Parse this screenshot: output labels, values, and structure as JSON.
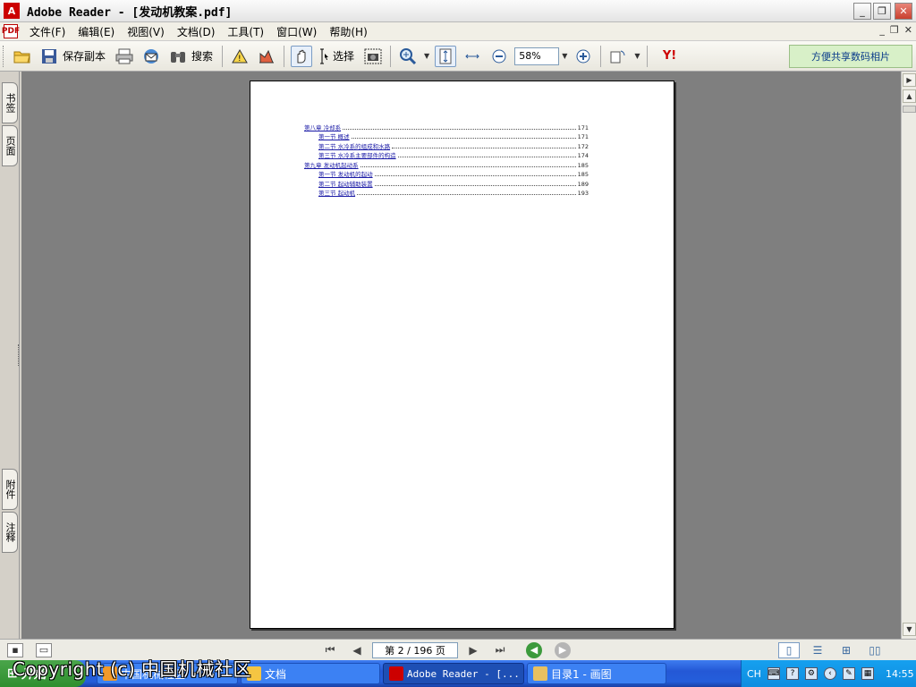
{
  "window": {
    "title": "Adobe Reader - [发动机教案.pdf]",
    "minimize": "_",
    "restore": "❐",
    "close": "✕",
    "app_icon": "adobe-reader-icon"
  },
  "menubar": {
    "items": [
      "文件(F)",
      "编辑(E)",
      "视图(V)",
      "文档(D)",
      "工具(T)",
      "窗口(W)",
      "帮助(H)"
    ],
    "doc_controls": [
      "_",
      "❐",
      "✕"
    ]
  },
  "toolbar": {
    "save_copy_label": "保存副本",
    "search_label": "搜索",
    "select_label": "选择",
    "zoom_value": "58%",
    "promo_label": "方便共享数码相片",
    "yahoo_label": "Y!"
  },
  "navpane": {
    "tabs_top": [
      "书签",
      "页面"
    ],
    "tabs_bottom": [
      "附件",
      "注释"
    ]
  },
  "document": {
    "toc": [
      {
        "level": 1,
        "label": "第八章  冷却系",
        "page": "171"
      },
      {
        "level": 2,
        "label": "第一节  概述",
        "page": "171"
      },
      {
        "level": 2,
        "label": "第二节  水冷系的组成和水路",
        "page": "172"
      },
      {
        "level": 2,
        "label": "第三节  水冷系主要部件的构造",
        "page": "174"
      },
      {
        "level": 1,
        "label": "第九章  发动机起动系",
        "page": "185"
      },
      {
        "level": 2,
        "label": "第一节  发动机的起动",
        "page": "185"
      },
      {
        "level": 2,
        "label": "第二节  起动辅助装置",
        "page": "189"
      },
      {
        "level": 2,
        "label": "第三节  起动机",
        "page": "193"
      }
    ]
  },
  "statusbar": {
    "page_indicator": "第 2 / 196 页",
    "first_page": "⏮",
    "prev_page": "◀",
    "next_page": "▶",
    "last_page": "⏭"
  },
  "taskbar": {
    "start_label": "开始",
    "tasks": [
      {
        "label": "中国机械社区",
        "active": false
      },
      {
        "label": "文档",
        "active": false
      },
      {
        "label": "Adobe Reader - [...",
        "active": true
      },
      {
        "label": "目录1 - 画图",
        "active": false
      }
    ],
    "tray": {
      "lang": "CH",
      "clock": "14:55"
    }
  },
  "watermark": "Copyright (c) 中国机械社区",
  "colors": {
    "link": "#1a1aa6",
    "doc_background": "#7f7f7f",
    "taskbar": "#245edb",
    "start_button": "#3c9a3c"
  }
}
